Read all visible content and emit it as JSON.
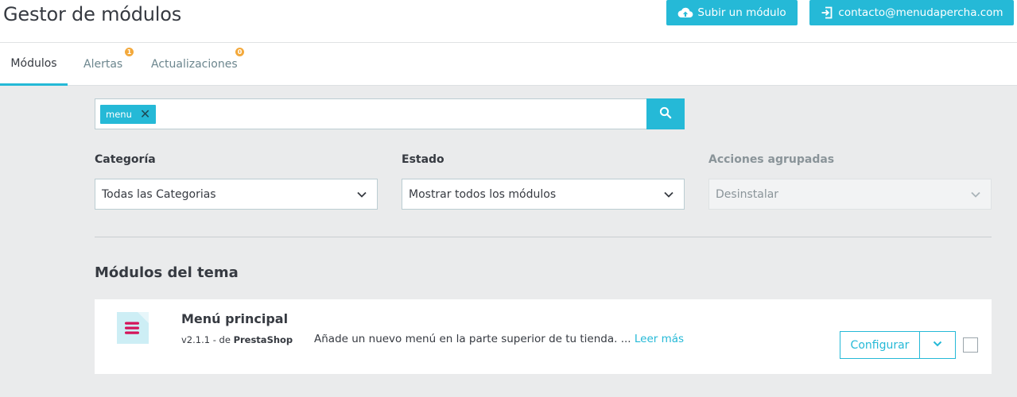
{
  "header": {
    "title": "Gestor de módulos",
    "upload_label": "Subir un módulo",
    "upload_icon": "cloud-upload-icon",
    "contact_label": "contacto@menudapercha.com",
    "contact_icon": "login-icon"
  },
  "tabs": [
    {
      "label": "Módulos",
      "active": true
    },
    {
      "label": "Alertas",
      "badge": "1"
    },
    {
      "label": "Actualizaciones",
      "badge": "0"
    }
  ],
  "search": {
    "tag": "menu",
    "search_icon": "search-icon"
  },
  "filters": {
    "category": {
      "label": "Categoría",
      "value": "Todas las Categorias"
    },
    "status": {
      "label": "Estado",
      "value": "Mostrar todos los módulos"
    },
    "bulk": {
      "label": "Acciones agrupadas",
      "value": "Desinstalar",
      "disabled": true
    }
  },
  "section": {
    "title": "Módulos del tema"
  },
  "module": {
    "name": "Menú principal",
    "version": "v2.1.1 - de",
    "author": "PrestaShop",
    "description": "Añade un nuevo menú en la parte superior de tu tienda. ...",
    "read_more": "Leer más",
    "configure_label": "Configurar",
    "logo_icon": "hamburger-menu-icon"
  },
  "colors": {
    "accent": "#25b9d7",
    "badge": "#f3a93c",
    "logo_bars": "#d4145a",
    "page_bg": "#eaebec"
  }
}
